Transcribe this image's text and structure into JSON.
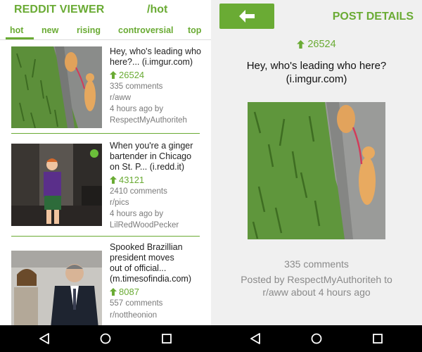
{
  "colors": {
    "accent": "#6aab34",
    "text": "#222222",
    "muted": "#7a7a7a",
    "navbar": "#000000"
  },
  "list_screen": {
    "app_title": "REDDIT VIEWER",
    "subreddit": "/hot",
    "tabs": [
      {
        "label": "hot",
        "selected": true
      },
      {
        "label": "new",
        "selected": false
      },
      {
        "label": "rising",
        "selected": false
      },
      {
        "label": "controversial",
        "selected": false
      },
      {
        "label": "top",
        "selected": false
      }
    ],
    "posts": [
      {
        "title_line1": "Hey, who's leading who",
        "title_line2": "here?... (i.imgur.com)",
        "score": "26524",
        "comments": "335 comments",
        "subreddit": "r/aww",
        "time": "4 hours ago by",
        "author": "RespectMyAuthoriteh",
        "thumbnail": "cat-on-leash"
      },
      {
        "title_line1": "When you're a ginger",
        "title_line2": "bartender in Chicago",
        "title_line3": "on St. P... (i.redd.it)",
        "score": "43121",
        "comments": "2410 comments",
        "subreddit": "r/pics",
        "time": "4 hours ago by",
        "author": "LilRedWoodPecker",
        "thumbnail": "bartender"
      },
      {
        "title_line1": "Spooked Brazillian",
        "title_line2": "president moves",
        "title_line3": "out of official...",
        "title_line4": "(m.timesofindia.com)",
        "score": "8087",
        "comments": "557 comments",
        "subreddit": "r/nottheonion",
        "thumbnail": "politicians"
      }
    ]
  },
  "detail_screen": {
    "title": "POST DETAILS",
    "back_icon": "arrow-left",
    "score": "26524",
    "post_title_line1": "Hey, who's leading who here?",
    "post_title_line2": "(i.imgur.com)",
    "comments": "335 comments",
    "posted_line1": "Posted by RespectMyAuthoriteh to",
    "posted_line2": "r/aww about 4 hours ago"
  },
  "navbar": {
    "buttons": [
      "back-triangle",
      "home-circle",
      "recents-square"
    ]
  }
}
